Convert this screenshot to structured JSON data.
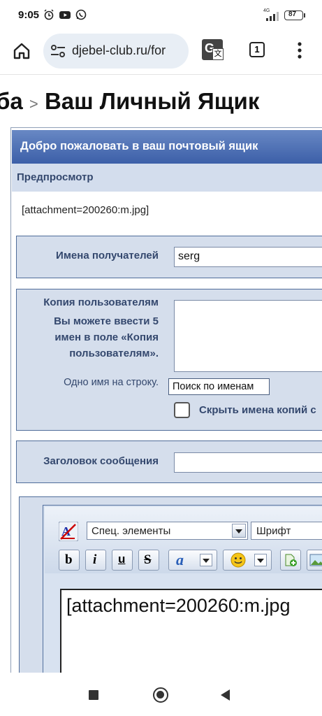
{
  "status": {
    "time": "9:05",
    "network": "4G",
    "battery": "87"
  },
  "browser": {
    "url": "djebel-club.ru/for",
    "tab_count": "1"
  },
  "page": {
    "heading_prefix": "ба",
    "heading_sep": ">",
    "heading_title": "Ваш Личный Ящик",
    "welcome": "Добро пожаловать в ваш почтовый ящик",
    "preview_label": "Предпросмотр",
    "preview_text": "[attachment=200260:m.jpg]",
    "recipients_label": "Имена получателей",
    "recipients_value": "serg",
    "cc_label": "Копия пользователям",
    "cc_hint": "Вы можете ввести 5 имен в поле «Копия пользователям».",
    "cc_note": "Одно имя на строку.",
    "search_names_button": "Поиск по именам",
    "hide_cc_label": "Скрыть имена копий с",
    "subject_label": "Заголовок сообщения",
    "editor": {
      "special_select": "Спец. элементы",
      "font_select": "Шрифт",
      "body_text": "[attachment=200260:m.jpg"
    }
  }
}
